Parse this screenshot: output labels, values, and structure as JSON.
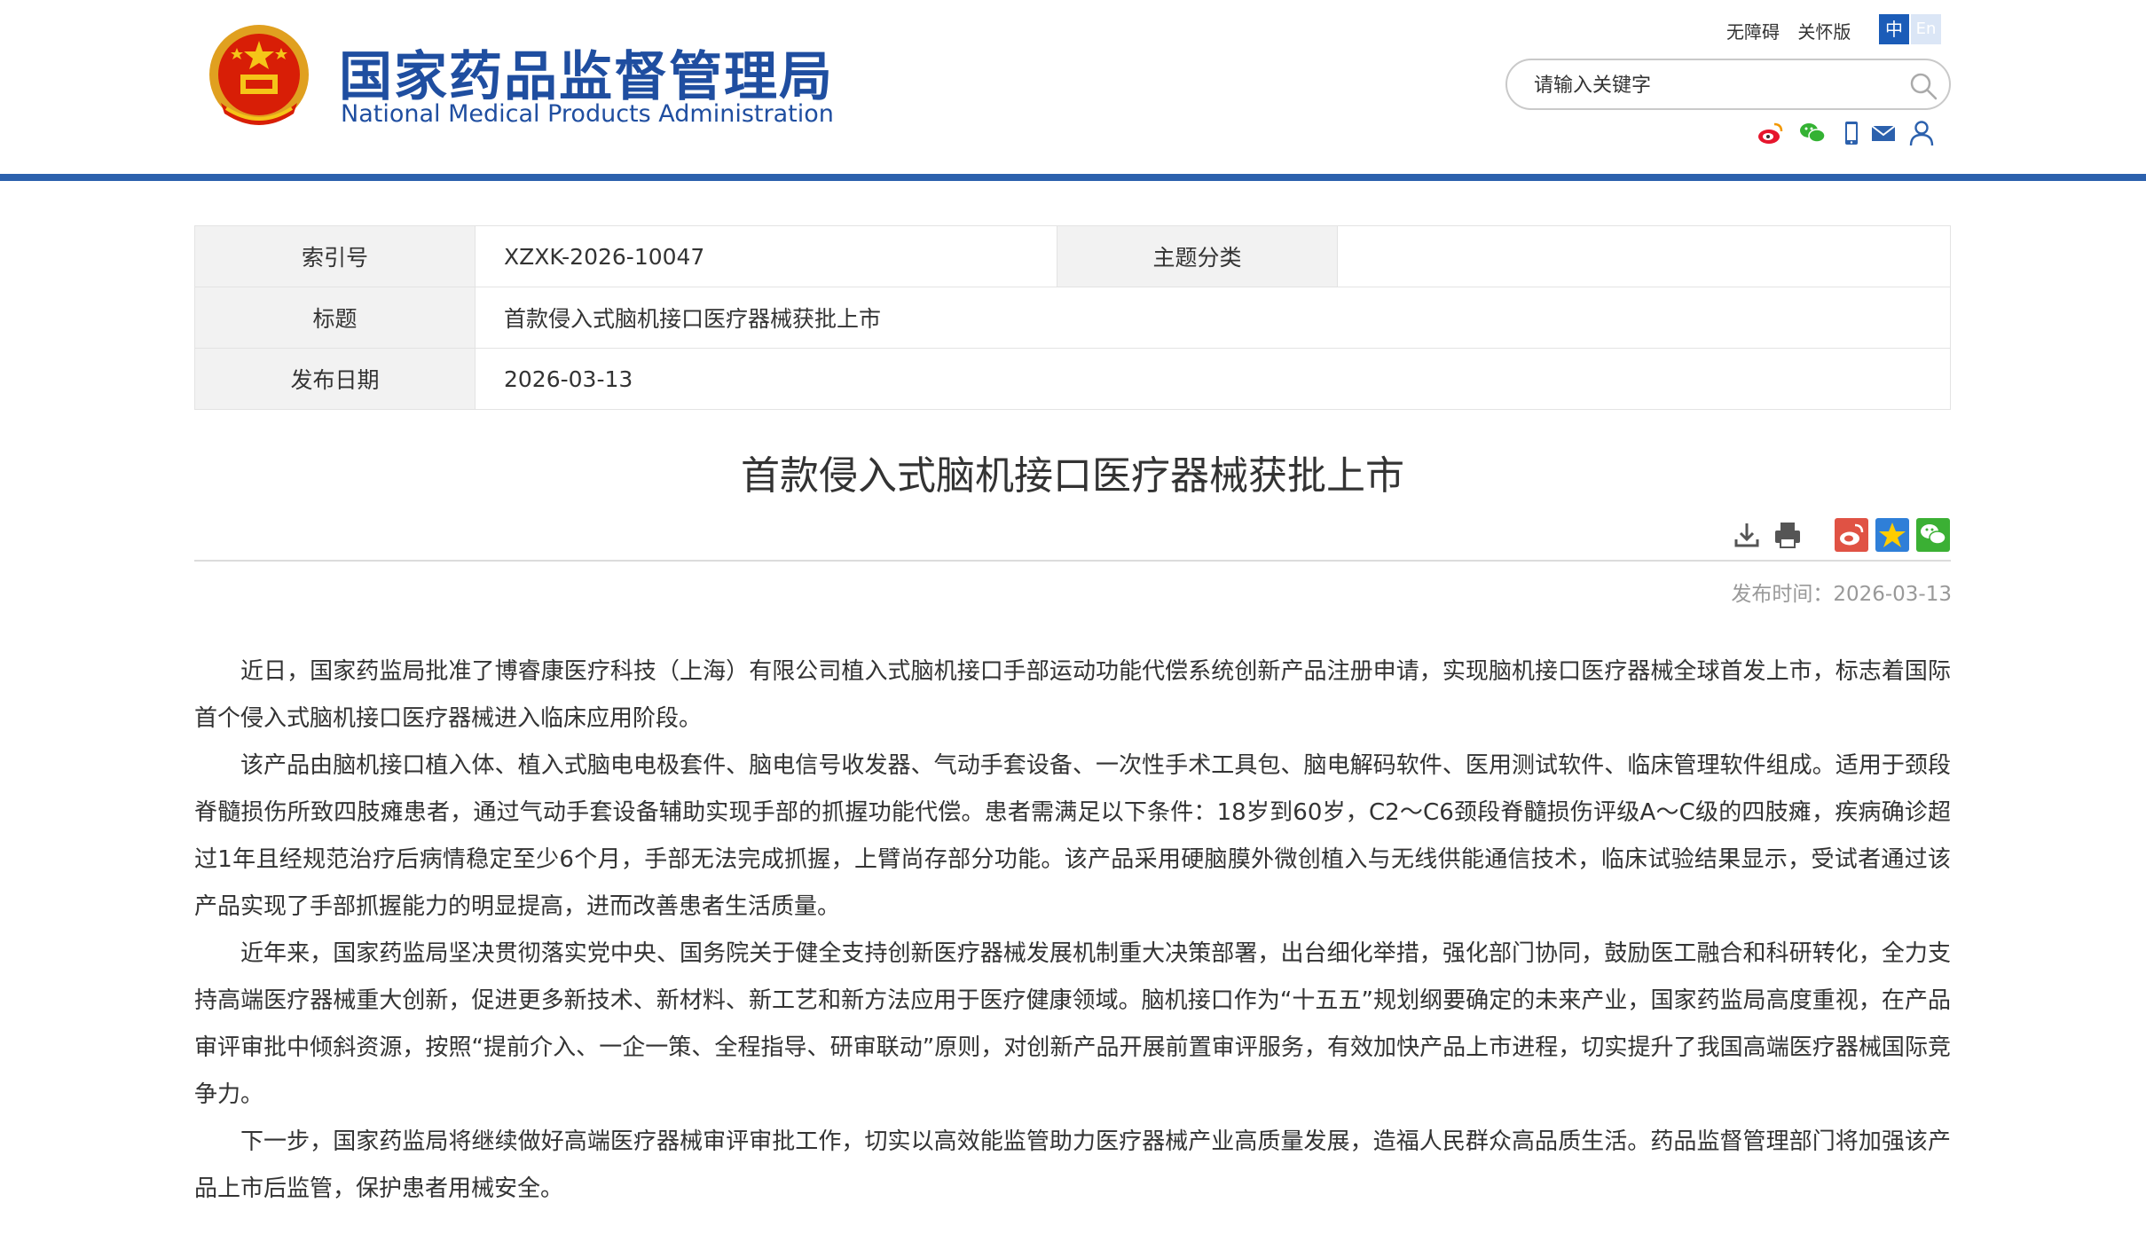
{
  "header": {
    "title_cn": "国家药品监督管理局",
    "title_en": "National Medical Products Administration",
    "links": [
      "无障碍",
      "关怀版"
    ],
    "lang_zh": "中",
    "lang_en": "En",
    "search_placeholder": "请输入关键字",
    "brand_color": "#2c61ad",
    "social_icons": [
      "weibo-icon",
      "wechat-icon",
      "mobile-icon",
      "mail-icon",
      "user-icon"
    ]
  },
  "info": {
    "index_label": "索引号",
    "index_value": "XZXK-2026-10047",
    "topic_label": "主题分类",
    "topic_value": "",
    "title_label": "标题",
    "title_value": "首款侵入式脑机接口医疗器械获批上市",
    "date_label": "发布日期",
    "date_value": "2026-03-13"
  },
  "article": {
    "title": "首款侵入式脑机接口医疗器械获批上市",
    "pubtime_label": "发布时间：",
    "pubtime_value": "2026-03-13",
    "tool_icons": [
      "download-icon",
      "print-icon",
      "weibo-share-icon",
      "favorite-star-icon",
      "wechat-share-icon"
    ],
    "paragraphs": [
      "近日，国家药监局批准了博睿康医疗科技（上海）有限公司植入式脑机接口手部运动功能代偿系统创新产品注册申请，实现脑机接口医疗器械全球首发上市，标志着国际首个侵入式脑机接口医疗器械进入临床应用阶段。",
      "该产品由脑机接口植入体、植入式脑电电极套件、脑电信号收发器、气动手套设备、一次性手术工具包、脑电解码软件、医用测试软件、临床管理软件组成。适用于颈段脊髓损伤所致四肢瘫患者，通过气动手套设备辅助实现手部的抓握功能代偿。患者需满足以下条件：18岁到60岁，C2～C6颈段脊髓损伤评级A～C级的四肢瘫，疾病确诊超过1年且经规范治疗后病情稳定至少6个月，手部无法完成抓握，上臂尚存部分功能。该产品采用硬脑膜外微创植入与无线供能通信技术，临床试验结果显示，受试者通过该产品实现了手部抓握能力的明显提高，进而改善患者生活质量。",
      "近年来，国家药监局坚决贯彻落实党中央、国务院关于健全支持创新医疗器械发展机制重大决策部署，出台细化举措，强化部门协同，鼓励医工融合和科研转化，全力支持高端医疗器械重大创新，促进更多新技术、新材料、新工艺和新方法应用于医疗健康领域。脑机接口作为“十五五”规划纲要确定的未来产业，国家药监局高度重视，在产品审评审批中倾斜资源，按照“提前介入、一企一策、全程指导、研审联动”原则，对创新产品开展前置审评服务，有效加快产品上市进程，切实提升了我国高端医疗器械国际竞争力。",
      "下一步，国家药监局将继续做好高端医疗器械审评审批工作，切实以高效能监管助力医疗器械产业高质量发展，造福人民群众高品质生活。药品监督管理部门将加强该产品上市后监管，保护患者用械安全。"
    ]
  }
}
